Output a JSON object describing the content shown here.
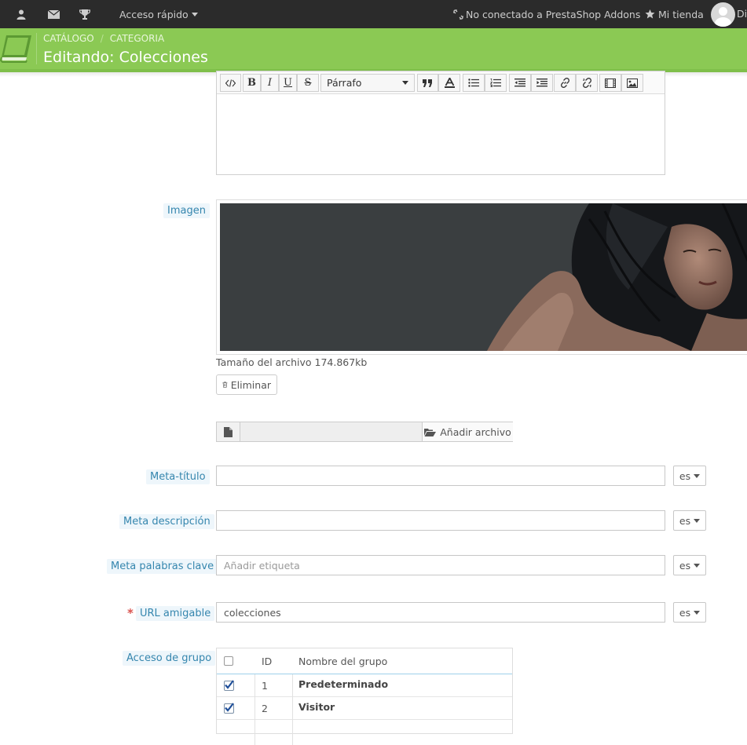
{
  "topbar": {
    "quick_access": "Acceso rápido",
    "addons_status": "No conectado a PrestaShop Addons",
    "my_store": "Mi tienda",
    "user_initial": "Di",
    "icons": [
      "user-icon",
      "envelope-icon",
      "trophy-icon",
      "unlink-icon",
      "star-icon"
    ]
  },
  "header": {
    "breadcrumb": [
      "CATÁLOGO",
      "CATEGORIA"
    ],
    "breadcrumb_separator": "/",
    "title": "Editando: Colecciones"
  },
  "editor": {
    "format_select": "Párrafo",
    "content": ""
  },
  "image": {
    "label": "Imagen",
    "file_size": "Tamaño del archivo 174.867kb",
    "delete_label": "Eliminar",
    "add_file_label": "Añadir archivo"
  },
  "fields": {
    "meta_title": {
      "label": "Meta-título",
      "value": "",
      "lang": "es"
    },
    "meta_description": {
      "label": "Meta descripción",
      "value": "",
      "lang": "es"
    },
    "meta_keywords": {
      "label": "Meta palabras clave",
      "placeholder": "Añadir etiqueta",
      "lang": "es"
    },
    "friendly_url": {
      "label": "URL amigable",
      "value": "colecciones",
      "lang": "es",
      "required_mark": "*"
    }
  },
  "group_access": {
    "label": "Acceso de grupo",
    "headers": {
      "id": "ID",
      "name": "Nombre del grupo"
    },
    "rows": [
      {
        "id": "1",
        "name": "Predeterminado",
        "checked": true
      },
      {
        "id": "2",
        "name": "Visitor",
        "checked": true
      }
    ]
  },
  "colors": {
    "header_green": "#8bc954",
    "topbar_dark": "#2b2b2b",
    "label_blue": "#3586ae"
  }
}
